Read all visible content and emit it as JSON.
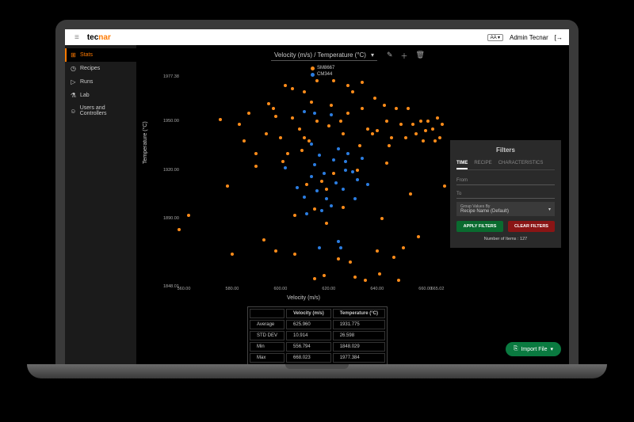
{
  "header": {
    "logo_left": "tec",
    "logo_right": "nar",
    "lang_badge": "AA ▾",
    "user": "Admin Tecnar"
  },
  "sidebar": {
    "items": [
      {
        "icon": "⊞",
        "label": "Stats",
        "active": true
      },
      {
        "icon": "◷",
        "label": "Recipes"
      },
      {
        "icon": "▷",
        "label": "Runs"
      },
      {
        "icon": "⚗",
        "label": "Lab"
      },
      {
        "icon": "☺",
        "label": "Users and Controllers"
      }
    ]
  },
  "chart": {
    "dropdown_label": "Velocity (m/s) / Temperature (°C)",
    "legend": [
      {
        "name": "SM8667",
        "color": "#ff8c1a"
      },
      {
        "name": "CM344",
        "color": "#2b7de1"
      }
    ]
  },
  "filters": {
    "title": "Filters",
    "tabs": [
      "TIME",
      "RECIPE",
      "CHARACTERISTICS"
    ],
    "active_tab": 0,
    "from_label": "From",
    "to_label": "To",
    "group_label": "Group Values By",
    "group_value": "Recipe Name (Default)",
    "apply": "APPLY FILTERS",
    "clear": "CLEAR FILTERS",
    "count_label": "Number of Items : 127"
  },
  "stats": {
    "cols": [
      "Velocity (m/s)",
      "Temperature (°C)"
    ],
    "rows": [
      {
        "label": "Average",
        "v": "625.960",
        "t": "1931.775"
      },
      {
        "label": "STD DEV",
        "v": "10.914",
        "t": "26.598"
      },
      {
        "label": "Min",
        "v": "556.794",
        "t": "1848.029"
      },
      {
        "label": "Max",
        "v": "668.023",
        "t": "1977.384"
      }
    ]
  },
  "import_label": "Import File",
  "chart_data": {
    "type": "scatter",
    "xlabel": "Velocity (m/s)",
    "ylabel": "Temperature (°C)",
    "xlim": [
      560,
      665.02
    ],
    "ylim": [
      1848.01,
      1977.38
    ],
    "xticks": [
      560,
      580,
      600,
      620,
      640,
      660,
      665.02
    ],
    "yticks": [
      1848.01,
      1890,
      1920,
      1950,
      1977.38
    ],
    "series": [
      {
        "name": "SM8667",
        "color": "#ff8c1a",
        "points": [
          [
            558,
            1883
          ],
          [
            562,
            1892
          ],
          [
            575,
            1951
          ],
          [
            578,
            1910
          ],
          [
            580,
            1868
          ],
          [
            583,
            1948
          ],
          [
            585,
            1938
          ],
          [
            590,
            1922
          ],
          [
            593,
            1877
          ],
          [
            595,
            1961
          ],
          [
            597,
            1958
          ],
          [
            598,
            1870
          ],
          [
            600,
            1940
          ],
          [
            602,
            1972
          ],
          [
            603,
            1930
          ],
          [
            605,
            1952
          ],
          [
            606,
            1868
          ],
          [
            608,
            1945
          ],
          [
            610,
            1940
          ],
          [
            612,
            1938
          ],
          [
            613,
            1962
          ],
          [
            614,
            1853
          ],
          [
            615,
            1950
          ],
          [
            618,
            1855
          ],
          [
            619,
            1908
          ],
          [
            620,
            1947
          ],
          [
            621,
            1960
          ],
          [
            622,
            1918
          ],
          [
            624,
            1865
          ],
          [
            625,
            1950
          ],
          [
            626,
            1942
          ],
          [
            628,
            1955
          ],
          [
            629,
            1863
          ],
          [
            630,
            1968
          ],
          [
            631,
            1854
          ],
          [
            632,
            1920
          ],
          [
            633,
            1935
          ],
          [
            634,
            1958
          ],
          [
            635,
            1852
          ],
          [
            636,
            1945
          ],
          [
            638,
            1942
          ],
          [
            639,
            1964
          ],
          [
            640,
            1944
          ],
          [
            641,
            1856
          ],
          [
            642,
            1890
          ],
          [
            643,
            1960
          ],
          [
            644,
            1950
          ],
          [
            645,
            1935
          ],
          [
            646,
            1940
          ],
          [
            647,
            1866
          ],
          [
            648,
            1958
          ],
          [
            649,
            1852
          ],
          [
            650,
            1948
          ],
          [
            652,
            1940
          ],
          [
            653,
            1958
          ],
          [
            654,
            1905
          ],
          [
            655,
            1948
          ],
          [
            656,
            1942
          ],
          [
            658,
            1950
          ],
          [
            659,
            1938
          ],
          [
            660,
            1944
          ],
          [
            661,
            1950
          ],
          [
            663,
            1945
          ],
          [
            664,
            1938
          ],
          [
            665,
            1952
          ],
          [
            666,
            1940
          ],
          [
            667,
            1948
          ],
          [
            668,
            1910
          ],
          [
            615,
            1975
          ],
          [
            610,
            1968
          ],
          [
            605,
            1970
          ],
          [
            622,
            1975
          ],
          [
            628,
            1972
          ],
          [
            634,
            1974
          ],
          [
            601,
            1925
          ],
          [
            609,
            1932
          ],
          [
            617,
            1913
          ],
          [
            626,
            1897
          ],
          [
            619,
            1887
          ],
          [
            606,
            1892
          ],
          [
            644,
            1924
          ],
          [
            651,
            1872
          ],
          [
            657,
            1879
          ],
          [
            640,
            1870
          ],
          [
            611,
            1911
          ],
          [
            614,
            1896
          ],
          [
            598,
            1953
          ],
          [
            594,
            1942
          ],
          [
            590,
            1930
          ],
          [
            587,
            1955
          ]
        ]
      },
      {
        "name": "CM344",
        "color": "#2b7de1",
        "points": [
          [
            602,
            1921
          ],
          [
            607,
            1909
          ],
          [
            610,
            1903
          ],
          [
            610,
            1956
          ],
          [
            611,
            1893
          ],
          [
            613,
            1916
          ],
          [
            614,
            1923
          ],
          [
            615,
            1907
          ],
          [
            616,
            1929
          ],
          [
            617,
            1895
          ],
          [
            618,
            1918
          ],
          [
            619,
            1902
          ],
          [
            621,
            1898
          ],
          [
            622,
            1926
          ],
          [
            623,
            1912
          ],
          [
            624,
            1933
          ],
          [
            625,
            1872
          ],
          [
            626,
            1908
          ],
          [
            627,
            1920
          ],
          [
            627,
            1925
          ],
          [
            628,
            1930
          ],
          [
            630,
            1919
          ],
          [
            631,
            1902
          ],
          [
            632,
            1914
          ],
          [
            634,
            1927
          ],
          [
            636,
            1911
          ],
          [
            616,
            1872
          ],
          [
            624,
            1876
          ],
          [
            614,
            1955
          ],
          [
            621,
            1954
          ],
          [
            613,
            1936
          ]
        ]
      }
    ]
  }
}
